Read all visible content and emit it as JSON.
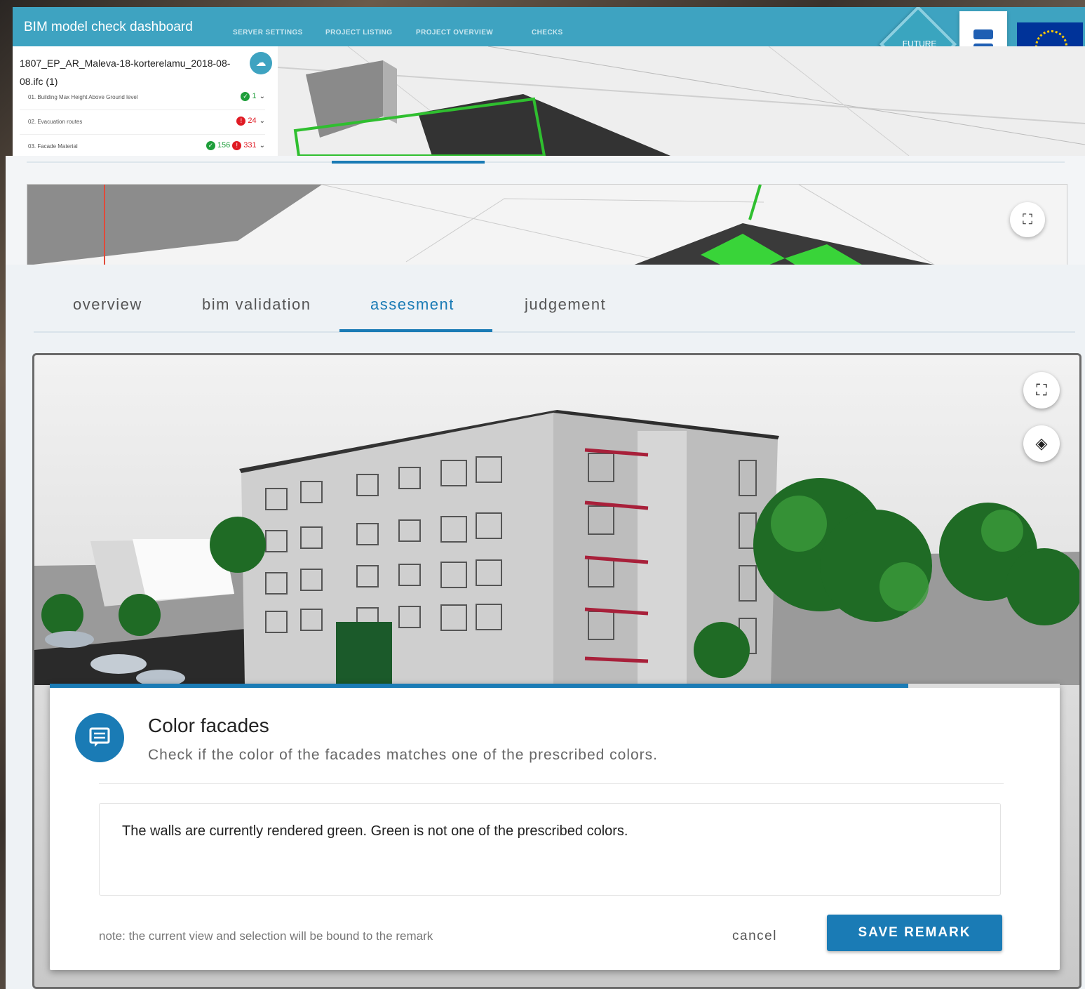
{
  "header": {
    "title": "BIM model check dashboard",
    "nav": [
      "SERVER SETTINGS",
      "PROJECT LISTING",
      "PROJECT OVERVIEW",
      "CHECKS"
    ],
    "future_logo": "FUTURE"
  },
  "file_panel": {
    "file_name": "1807_EP_AR_Maleva-18-korterelamu_2018-08-08.ifc (1)",
    "checks": [
      {
        "label": "01. Building Max Height Above Ground level",
        "ok": "1",
        "err": ""
      },
      {
        "label": "02. Evacuation routes",
        "ok": "",
        "err": "24"
      },
      {
        "label": "03. Facade Material",
        "ok": "156",
        "err": "331"
      }
    ]
  },
  "tabs": [
    "overview",
    "bim validation",
    "assesment",
    "judgement"
  ],
  "active_tab": "assesment",
  "remark": {
    "title": "Color facades",
    "description": "Check if the color of the facades matches one of the prescribed colors.",
    "text": "The walls are currently rendered green. Green is not one of the prescribed colors.",
    "note": "note: the current view and selection will be bound to the remark",
    "cancel_label": "cancel",
    "save_label": "SAVE REMARK",
    "progress": 0.85
  },
  "colors": {
    "header_bg": "#3ea3c1",
    "accent": "#1a7bb5",
    "ok": "#1e9e3a",
    "error": "#e01b24"
  },
  "icons": {
    "upload": "cloud-upload-icon",
    "fullscreen": "fullscreen-icon",
    "layers": "layers-icon",
    "remark": "comment-icon"
  }
}
